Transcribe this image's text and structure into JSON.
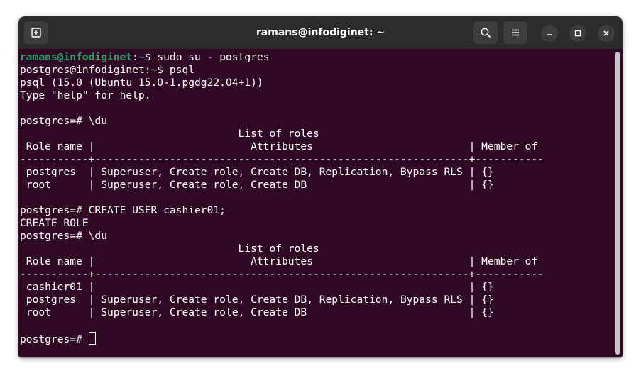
{
  "window": {
    "title": "ramans@infodiginet: ~"
  },
  "terminal": {
    "first_prompt": {
      "user_host": "ramans@infodiginet",
      "separator": ":",
      "path": "~",
      "symbol": "$",
      "command": " sudo su - postgres"
    },
    "lines": [
      "postgres@infodiginet:~$ psql",
      "psql (15.0 (Ubuntu 15.0-1.pgdg22.04+1))",
      "Type \"help\" for help.",
      "",
      "postgres=# \\du",
      "                                   List of roles",
      " Role name |                         Attributes                         | Member of",
      "-----------+------------------------------------------------------------+-----------",
      " postgres  | Superuser, Create role, Create DB, Replication, Bypass RLS | {}",
      " root      | Superuser, Create role, Create DB                          | {}",
      "",
      "postgres=# CREATE USER cashier01;",
      "CREATE ROLE",
      "postgres=# \\du",
      "                                   List of roles",
      " Role name |                         Attributes                         | Member of",
      "-----------+------------------------------------------------------------+-----------",
      " cashier01 |                                                            | {}",
      " postgres  | Superuser, Create role, Create DB, Replication, Bypass RLS | {}",
      " root      | Superuser, Create role, Create DB                          | {}",
      ""
    ],
    "final_prompt": "postgres=# "
  },
  "icons": {
    "new_tab": "new-tab-icon",
    "search": "search-icon",
    "menu": "hamburger-menu-icon",
    "minimize": "minimize-icon",
    "maximize": "maximize-icon",
    "close": "close-icon"
  },
  "colors": {
    "terminal_bg": "#300a24",
    "titlebar_bg": "#2c2c2c",
    "prompt_user": "#26a269",
    "prompt_path": "#3a6bd6",
    "text": "#ffffff"
  }
}
